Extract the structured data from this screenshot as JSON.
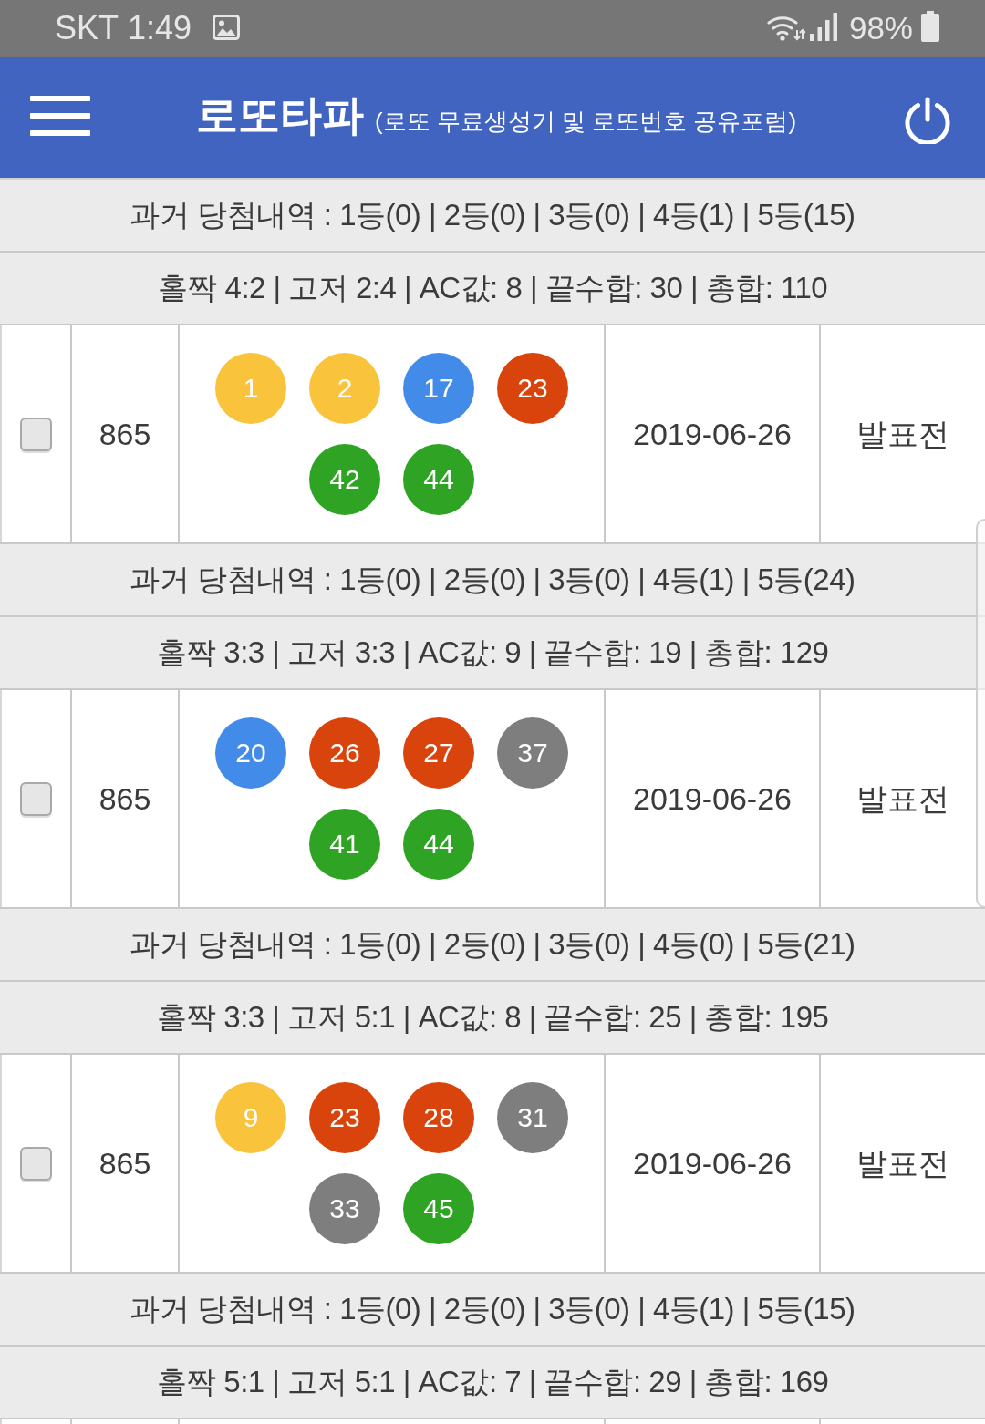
{
  "status_bar": {
    "carrier": "SKT",
    "time": "1:49",
    "battery": "98%"
  },
  "header": {
    "title": "로또타파",
    "subtitle": "(로또 무료생성기 및 로또번호 공유포럼)"
  },
  "entries": [
    {
      "history": "과거 당첨내역 : 1등(0) | 2등(0) | 3등(0) | 4등(1) | 5등(15)",
      "summary": "홀짝 4:2 | 고저 2:4 | AC값: 8 | 끝수합: 30 | 총합: 110"
    },
    {
      "ticket": {
        "checked": false,
        "round": "865",
        "numbers": [
          {
            "value": "1",
            "color": "#f9c33b"
          },
          {
            "value": "2",
            "color": "#f9c33b"
          },
          {
            "value": "17",
            "color": "#428be8"
          },
          {
            "value": "23",
            "color": "#d8440c"
          },
          {
            "value": "42",
            "color": "#2fa424"
          },
          {
            "value": "44",
            "color": "#2fa424"
          }
        ],
        "date": "2019-06-26",
        "status": "발표전"
      },
      "history": "과거 당첨내역 : 1등(0) | 2등(0) | 3등(0) | 4등(1) | 5등(24)",
      "summary": "홀짝 3:3 | 고저 3:3 | AC값: 9 | 끝수합: 19 | 총합: 129"
    },
    {
      "ticket": {
        "checked": false,
        "round": "865",
        "numbers": [
          {
            "value": "20",
            "color": "#428be8"
          },
          {
            "value": "26",
            "color": "#d8440c"
          },
          {
            "value": "27",
            "color": "#d8440c"
          },
          {
            "value": "37",
            "color": "#7e7e7e"
          },
          {
            "value": "41",
            "color": "#2fa424"
          },
          {
            "value": "44",
            "color": "#2fa424"
          }
        ],
        "date": "2019-06-26",
        "status": "발표전"
      },
      "history": "과거 당첨내역 : 1등(0) | 2등(0) | 3등(0) | 4등(0) | 5등(21)",
      "summary": "홀짝 3:3 | 고저 5:1 | AC값: 8 | 끝수합: 25 | 총합: 195"
    },
    {
      "ticket": {
        "checked": false,
        "round": "865",
        "numbers": [
          {
            "value": "9",
            "color": "#f9c33b"
          },
          {
            "value": "23",
            "color": "#d8440c"
          },
          {
            "value": "28",
            "color": "#d8440c"
          },
          {
            "value": "31",
            "color": "#7e7e7e"
          },
          {
            "value": "33",
            "color": "#7e7e7e"
          },
          {
            "value": "45",
            "color": "#2fa424"
          }
        ],
        "date": "2019-06-26",
        "status": "발표전"
      },
      "history": "과거 당첨내역 : 1등(0) | 2등(0) | 3등(0) | 4등(1) | 5등(15)",
      "summary": "홀짝 5:1 | 고저 5:1 | AC값: 7 | 끝수합: 29 | 총합: 169"
    }
  ]
}
